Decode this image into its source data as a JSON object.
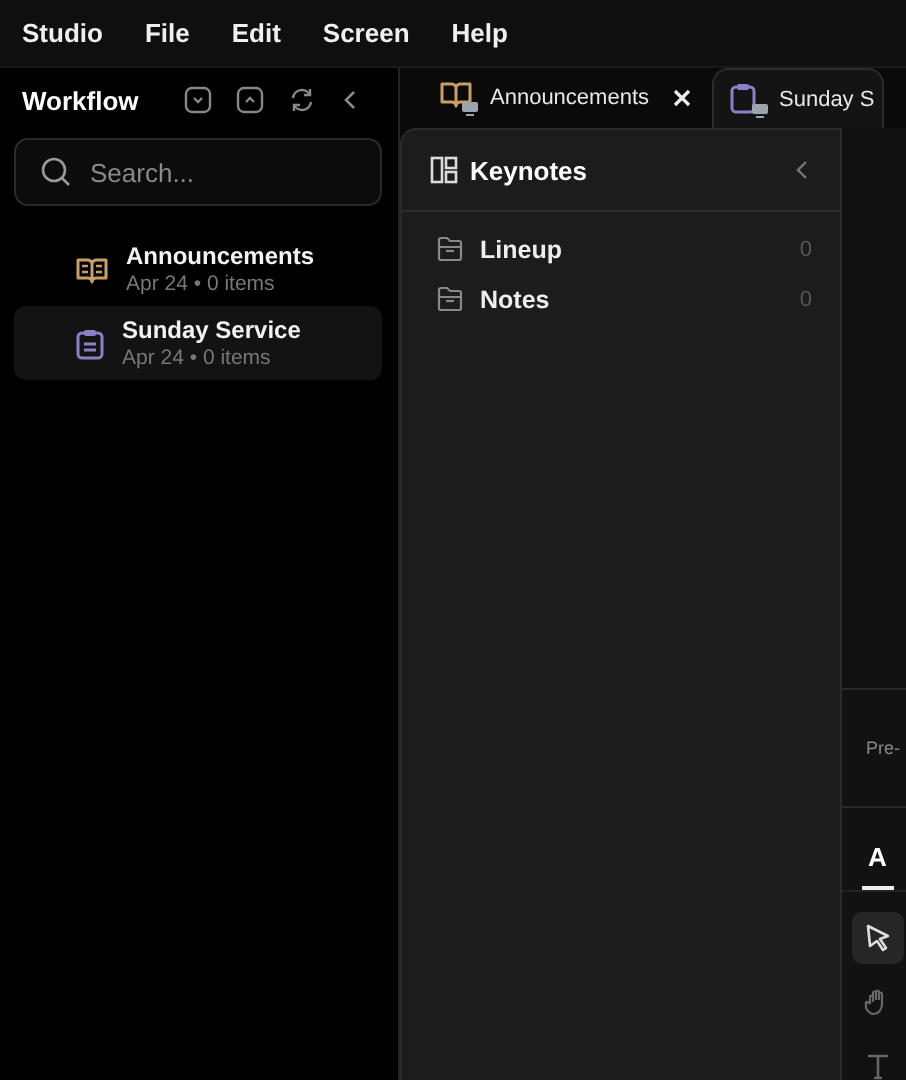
{
  "menu": [
    "Studio",
    "File",
    "Edit",
    "Screen",
    "Help"
  ],
  "sidebar": {
    "title": "Workflow",
    "search": {
      "placeholder": "Search..."
    },
    "items": [
      {
        "kind": "book",
        "title": "Announcements",
        "meta": "Apr 24 • 0 items",
        "selected": false
      },
      {
        "kind": "clipboard",
        "title": "Sunday Service",
        "meta": "Apr 24 • 0 items",
        "selected": true
      }
    ]
  },
  "tabs": [
    {
      "kind": "book",
      "label": "Announcements",
      "selected": false,
      "closable": true
    },
    {
      "kind": "clipboard",
      "label": "Sunday S",
      "selected": true,
      "closable": false
    }
  ],
  "keynotes": {
    "title": "Keynotes",
    "folders": [
      {
        "name": "Lineup",
        "count": "0"
      },
      {
        "name": "Notes",
        "count": "0"
      }
    ]
  },
  "side_panel": {
    "section_label": "Pre-",
    "tabs": [
      {
        "label": "A",
        "selected": true
      }
    ],
    "tools": [
      {
        "kind": "pointer",
        "selected": true
      },
      {
        "kind": "hand",
        "selected": false
      },
      {
        "kind": "text",
        "selected": false
      }
    ]
  }
}
